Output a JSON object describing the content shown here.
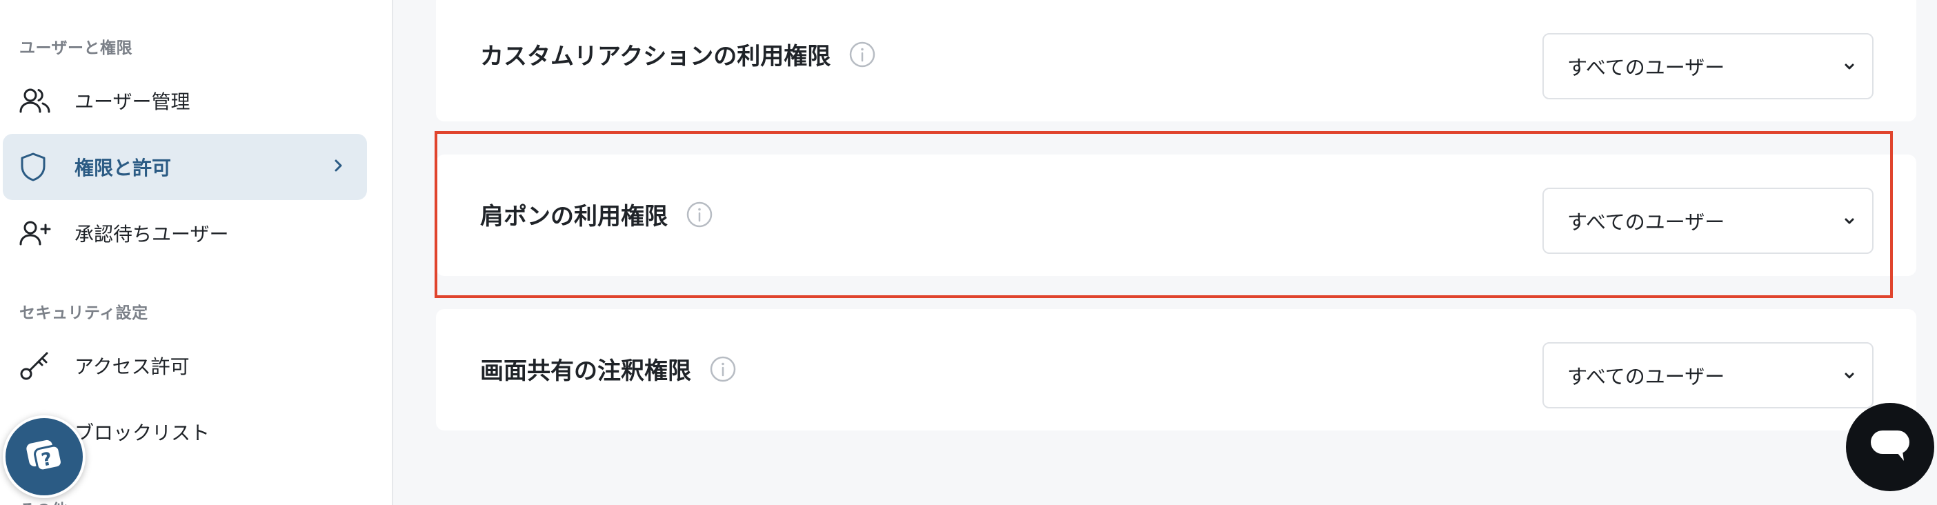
{
  "sidebar": {
    "section_users": "ユーザーと権限",
    "items_users": [
      {
        "label": "ユーザー管理",
        "icon": "users-icon"
      },
      {
        "label": "権限と許可",
        "icon": "shield-icon",
        "active": true
      },
      {
        "label": "承認待ちユーザー",
        "icon": "user-plus-icon"
      }
    ],
    "section_security": "セキュリティ設定",
    "items_security": [
      {
        "label": "アクセス許可",
        "icon": "key-icon"
      },
      {
        "label": "ブロックリスト",
        "icon": "block-icon"
      }
    ],
    "section_other": "その他"
  },
  "permissions": [
    {
      "title": "カスタムリアクションの利用権限",
      "value": "すべてのユーザー"
    },
    {
      "title": "肩ポンの利用権限",
      "value": "すべてのユーザー"
    },
    {
      "title": "画面共有の注釈権限",
      "value": "すべてのユーザー"
    }
  ],
  "colors": {
    "accent": "#2b5b84",
    "active_bg": "#e3ebf2",
    "highlight": "#e0442d",
    "chat_fab": "#0f1216"
  }
}
